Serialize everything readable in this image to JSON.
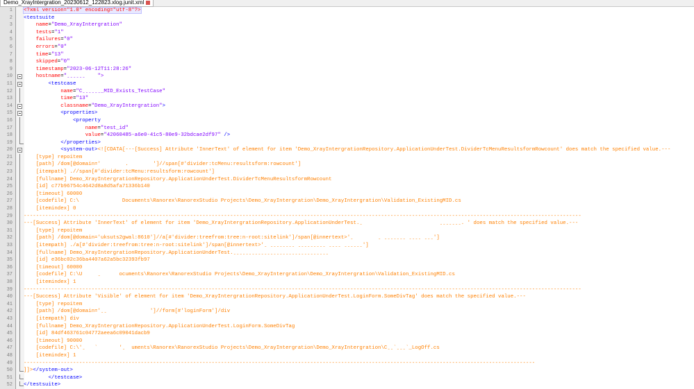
{
  "tab": {
    "title": "Demo_XrayIntergration_20230612_122823.xlog.junit.xml"
  },
  "colors": {
    "tag": "#0000ff",
    "attr": "#ff0000",
    "value": "#8000ff",
    "cdata": "#ff8000"
  },
  "lines": [
    {
      "n": "1",
      "fold": "",
      "indent": "",
      "segs": [
        {
          "c": "pi",
          "t": "<?xml version=\"1.0\" encoding=\"utf-8\"?>"
        }
      ],
      "current": true
    },
    {
      "n": "2",
      "fold": "",
      "indent": "",
      "segs": [
        {
          "c": "tag",
          "t": "<testsuite"
        }
      ]
    },
    {
      "n": "3",
      "fold": "",
      "indent": "    ",
      "segs": [
        {
          "c": "attr",
          "t": "name"
        },
        {
          "c": "plain",
          "t": "="
        },
        {
          "c": "val",
          "t": "\"Demo_XrayIntergration\""
        }
      ]
    },
    {
      "n": "4",
      "fold": "",
      "indent": "    ",
      "segs": [
        {
          "c": "attr",
          "t": "tests"
        },
        {
          "c": "plain",
          "t": "="
        },
        {
          "c": "val",
          "t": "\"1\""
        }
      ]
    },
    {
      "n": "5",
      "fold": "",
      "indent": "    ",
      "segs": [
        {
          "c": "attr",
          "t": "failures"
        },
        {
          "c": "plain",
          "t": "="
        },
        {
          "c": "val",
          "t": "\"0\""
        }
      ]
    },
    {
      "n": "6",
      "fold": "",
      "indent": "    ",
      "segs": [
        {
          "c": "attr",
          "t": "errors"
        },
        {
          "c": "plain",
          "t": "="
        },
        {
          "c": "val",
          "t": "\"0\""
        }
      ]
    },
    {
      "n": "7",
      "fold": "",
      "indent": "    ",
      "segs": [
        {
          "c": "attr",
          "t": "time"
        },
        {
          "c": "plain",
          "t": "="
        },
        {
          "c": "val",
          "t": "\"13\""
        }
      ]
    },
    {
      "n": "8",
      "fold": "",
      "indent": "    ",
      "segs": [
        {
          "c": "attr",
          "t": "skipped"
        },
        {
          "c": "plain",
          "t": "="
        },
        {
          "c": "val",
          "t": "\"0\""
        }
      ]
    },
    {
      "n": "9",
      "fold": "",
      "indent": "    ",
      "segs": [
        {
          "c": "attr",
          "t": "timestamp"
        },
        {
          "c": "plain",
          "t": "="
        },
        {
          "c": "val",
          "t": "\"2023-06-12T11:28:26\""
        }
      ]
    },
    {
      "n": "10",
      "fold": "box",
      "indent": "    ",
      "segs": [
        {
          "c": "attr",
          "t": "hostname"
        },
        {
          "c": "plain",
          "t": "="
        },
        {
          "c": "val",
          "t": "\"ˍˍˍˍˍˍ    \">"
        }
      ]
    },
    {
      "n": "11",
      "fold": "box",
      "indent": "        ",
      "segs": [
        {
          "c": "tag",
          "t": "<testcase"
        }
      ]
    },
    {
      "n": "12",
      "fold": "vline",
      "indent": "            ",
      "segs": [
        {
          "c": "attr",
          "t": "name"
        },
        {
          "c": "plain",
          "t": "="
        },
        {
          "c": "val",
          "t": "\"Cˍˍˍˍˍˍ_MID_Exists_TestCase\""
        }
      ]
    },
    {
      "n": "13",
      "fold": "vline",
      "indent": "            ",
      "segs": [
        {
          "c": "attr",
          "t": "time"
        },
        {
          "c": "plain",
          "t": "="
        },
        {
          "c": "val",
          "t": "\"13\""
        }
      ]
    },
    {
      "n": "14",
      "fold": "box",
      "indent": "            ",
      "segs": [
        {
          "c": "attr",
          "t": "classname"
        },
        {
          "c": "plain",
          "t": "="
        },
        {
          "c": "val",
          "t": "\"Demo_XrayIntergration\""
        },
        {
          "c": "tag",
          "t": ">"
        }
      ]
    },
    {
      "n": "15",
      "fold": "box",
      "indent": "            ",
      "segs": [
        {
          "c": "tag",
          "t": "<properties>"
        }
      ]
    },
    {
      "n": "16",
      "fold": "vline",
      "indent": "                ",
      "segs": [
        {
          "c": "tag",
          "t": "<property"
        }
      ]
    },
    {
      "n": "17",
      "fold": "vline",
      "indent": "                    ",
      "segs": [
        {
          "c": "attr",
          "t": "name"
        },
        {
          "c": "plain",
          "t": "="
        },
        {
          "c": "val",
          "t": "\"test_id\""
        }
      ]
    },
    {
      "n": "18",
      "fold": "vline",
      "indent": "                    ",
      "segs": [
        {
          "c": "attr",
          "t": "value"
        },
        {
          "c": "plain",
          "t": "="
        },
        {
          "c": "val",
          "t": "\"42060485-a6e0-41c5-80e9-32bdcae2df97\""
        },
        {
          "c": "tag",
          "t": " />"
        }
      ]
    },
    {
      "n": "19",
      "fold": "end",
      "indent": "            ",
      "segs": [
        {
          "c": "tag",
          "t": "</properties>"
        }
      ]
    },
    {
      "n": "20",
      "fold": "box",
      "indent": "            ",
      "segs": [
        {
          "c": "tag",
          "t": "<system-out>"
        },
        {
          "c": "cdata",
          "t": "<![CDATA[---[Success] Attribute 'InnerText' of element for item 'Demo_XrayIntergrationRepository.ApplicationUnderTest.DividerTcMenuResultsformRowcount' does match the specified value.---"
        }
      ]
    },
    {
      "n": "21",
      "fold": "vline",
      "indent": "    ",
      "segs": [
        {
          "c": "cdata",
          "t": "[type] repoitem"
        }
      ]
    },
    {
      "n": "22",
      "fold": "vline",
      "indent": "    ",
      "segs": [
        {
          "c": "cdata",
          "t": "[path] /dom[@domain='        .        ']//span[#'divider:tcMenu:resultsform:rowcount']"
        }
      ]
    },
    {
      "n": "23",
      "fold": "vline",
      "indent": "    ",
      "segs": [
        {
          "c": "cdata",
          "t": "[itempath] .//span[#'divider:tcMenu:resultsform:rowcount']"
        }
      ]
    },
    {
      "n": "24",
      "fold": "vline",
      "indent": "    ",
      "segs": [
        {
          "c": "cdata",
          "t": "[fullname] Demo_XrayIntergrationRepository.ApplicationUnderTest.DividerTcMenuResultsformRowcount"
        }
      ]
    },
    {
      "n": "25",
      "fold": "vline",
      "indent": "    ",
      "segs": [
        {
          "c": "cdata",
          "t": "[id] c77b96754c4642d8a8d5afa71336b140"
        }
      ]
    },
    {
      "n": "26",
      "fold": "vline",
      "indent": "    ",
      "segs": [
        {
          "c": "cdata",
          "t": "[timeout] 60000"
        }
      ]
    },
    {
      "n": "27",
      "fold": "vline",
      "indent": "    ",
      "segs": [
        {
          "c": "cdata",
          "t": "[codefile] C:\\              Documents\\Ranorex\\RanorexStudio Projects\\Demo_XrayIntergration\\Demo_XrayIntergration\\Validation_ExistingMID.cs"
        }
      ]
    },
    {
      "n": "28",
      "fold": "vline",
      "indent": "    ",
      "segs": [
        {
          "c": "cdata",
          "t": "[itemindex] 0"
        }
      ]
    },
    {
      "n": "29",
      "fold": "vline",
      "indent": "",
      "segs": [
        {
          "c": "cdata",
          "t": "-------------------------------------------------------------------------------------------------------------------------------------------------------------------------------------"
        }
      ]
    },
    {
      "n": "30",
      "fold": "vline",
      "indent": "",
      "segs": [
        {
          "c": "cdata",
          "t": "---[Success] Attribute 'InnerText' of element for item 'Demo_XrayIntergrationRepository.ApplicationUnderTest.ˍ                         ˍˍˍˍˍˍˍ. ' does match the specified value.---"
        }
      ]
    },
    {
      "n": "31",
      "fold": "vline",
      "indent": "    ",
      "segs": [
        {
          "c": "cdata",
          "t": "[type] repoitem"
        }
      ]
    },
    {
      "n": "32",
      "fold": "vline",
      "indent": "    ",
      "segs": [
        {
          "c": "cdata",
          "t": "[path] /dom[@domain='uksuts2gwal:8610']//a[#'divider:treefrom:tree:n-root:sitelink']/span[@innertext>'ˍ        ˍ ˍˍˍˍˍˍˍ ˍˍˍˍ ˍˍˍ']"
        }
      ]
    },
    {
      "n": "33",
      "fold": "vline",
      "indent": "    ",
      "segs": [
        {
          "c": "cdata",
          "t": "[itempath] ./a[#'divider:treefrom:tree:n-root:sitelink']/span[@innertext>'ˍ ˍˍˍˍˍˍˍˍ ˍˍˍˍˍˍˍˍˍ ˍˍˍˍ ˍˍˍˍˍˍ']"
        }
      ]
    },
    {
      "n": "34",
      "fold": "vline",
      "indent": "    ",
      "segs": [
        {
          "c": "cdata",
          "t": "[fullname] Demo_XrayIntergrationRepository.ApplicationUnderTest.ˍˍˍˍˍˍˍˍˍˍˍˍˍˍˍˍˍˍˍˍˍˍˍˍˍˍˍˍˍˍˍ"
        }
      ]
    },
    {
      "n": "35",
      "fold": "vline",
      "indent": "    ",
      "segs": [
        {
          "c": "cdata",
          "t": "[id] e36bc02c36ba4407a62a5bc32393fb97"
        }
      ]
    },
    {
      "n": "36",
      "fold": "vline",
      "indent": "    ",
      "segs": [
        {
          "c": "cdata",
          "t": "[timeout] 60000"
        }
      ]
    },
    {
      "n": "37",
      "fold": "vline",
      "indent": "    ",
      "segs": [
        {
          "c": "cdata",
          "t": "[codefile] C:\\U     ˍ      ocuments\\Ranorex\\RanorexStudio Projects\\Demo_XrayIntergration\\Demo_XrayIntergration\\Validation_ExistingMID.cs"
        }
      ]
    },
    {
      "n": "38",
      "fold": "vline",
      "indent": "    ",
      "segs": [
        {
          "c": "cdata",
          "t": "[itemindex] 1"
        }
      ]
    },
    {
      "n": "39",
      "fold": "vline",
      "indent": "",
      "segs": [
        {
          "c": "cdata",
          "t": "-------------------------------------------------------------------------------------------------------------------------------------------------------------------------------------"
        }
      ]
    },
    {
      "n": "40",
      "fold": "vline",
      "indent": "",
      "segs": [
        {
          "c": "cdata",
          "t": "---[Success] Attribute 'Visible' of element for item 'Demo_XrayIntergrationRepository.ApplicationUnderTest.LoginForm.SomeDivTag' does match the specified value.---"
        }
      ]
    },
    {
      "n": "41",
      "fold": "vline",
      "indent": "    ",
      "segs": [
        {
          "c": "cdata",
          "t": "[type] repoitem"
        }
      ]
    },
    {
      "n": "42",
      "fold": "vline",
      "indent": "    ",
      "segs": [
        {
          "c": "cdata",
          "t": "[path] /dom[@domain='ˍˍ              ']//form[#'loginForm']/div"
        }
      ]
    },
    {
      "n": "43",
      "fold": "vline",
      "indent": "    ",
      "segs": [
        {
          "c": "cdata",
          "t": "[itempath] div"
        }
      ]
    },
    {
      "n": "44",
      "fold": "vline",
      "indent": "    ",
      "segs": [
        {
          "c": "cdata",
          "t": "[fullname] Demo_XrayIntergrationRepository.ApplicationUnderTest.LoginForm.SomeDivTag"
        }
      ]
    },
    {
      "n": "45",
      "fold": "vline",
      "indent": "    ",
      "segs": [
        {
          "c": "cdata",
          "t": "[id] 84df463761c04772aeea6c09041dacb9"
        }
      ]
    },
    {
      "n": "46",
      "fold": "vline",
      "indent": "    ",
      "segs": [
        {
          "c": "cdata",
          "t": "[timeout] 90000"
        }
      ]
    },
    {
      "n": "47",
      "fold": "vline",
      "indent": "    ",
      "segs": [
        {
          "c": "cdata",
          "t": "[codefile] C:\\'ˍ   `       'ˍ  uments\\Ranorex\\RanorexStudio Projects\\Demo_XrayIntergration\\Demo_XrayIntergration\\Cˍˍ`ˍˍˍ`_LogOff.cs"
        }
      ]
    },
    {
      "n": "48",
      "fold": "vline",
      "indent": "    ",
      "segs": [
        {
          "c": "cdata",
          "t": "[itemindex] 1"
        }
      ]
    },
    {
      "n": "49",
      "fold": "vline",
      "indent": "",
      "segs": [
        {
          "c": "cdata",
          "t": "----------------------------------------------------------------------------------------------------------------------------------------------------------------------"
        }
      ]
    },
    {
      "n": "50",
      "fold": "end",
      "indent": "",
      "segs": [
        {
          "c": "cdata",
          "t": "]]>"
        },
        {
          "c": "tag",
          "t": "</system-out>"
        }
      ]
    },
    {
      "n": "51",
      "fold": "end",
      "indent": "        ",
      "segs": [
        {
          "c": "tag",
          "t": "</testcase>"
        }
      ]
    },
    {
      "n": "52",
      "fold": "end",
      "indent": "",
      "segs": [
        {
          "c": "tag",
          "t": "</testsuite>"
        }
      ]
    }
  ]
}
